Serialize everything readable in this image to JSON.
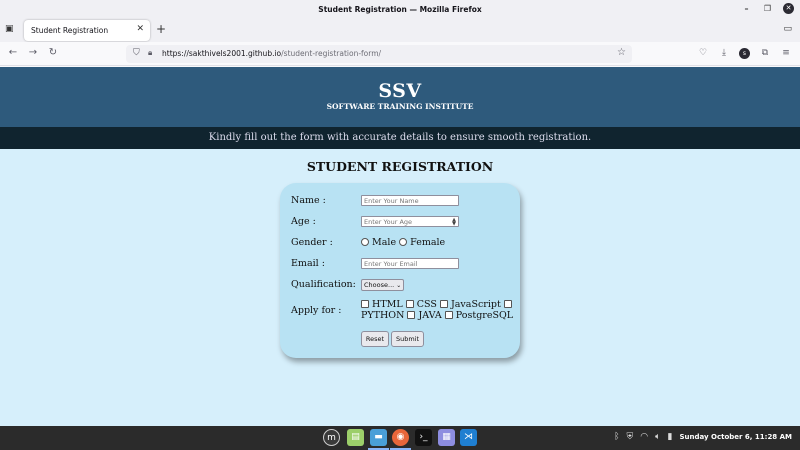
{
  "window": {
    "title": "Student Registration — Mozilla Firefox",
    "minimize_icon": "minimize-icon",
    "restore_icon": "restore-icon",
    "close_icon": "close-icon"
  },
  "tabs": [
    {
      "label": "Student Registration",
      "active": true
    }
  ],
  "navbar": {
    "url_domain": "https://sakthivels2001.github.io",
    "url_path": "/student-registration-form/",
    "icons": [
      "back-icon",
      "forward-icon",
      "reload-icon",
      "shield-icon",
      "lock-icon",
      "bookmark-star-icon",
      "pocket-icon",
      "download-icon",
      "account-icon",
      "extensions-icon",
      "menu-icon"
    ],
    "account_initial": "s"
  },
  "site": {
    "brand": "SSV",
    "brand_subtitle": "SOFTWARE TRAINING INSTITUTE",
    "banner_text": "Kindly fill out the form with accurate details to ensure smooth registration.",
    "header_color": "#2e5a7c",
    "banner_color": "#10242f",
    "page_bg": "#d6effb",
    "card_bg": "#b8e2f3"
  },
  "form": {
    "title": "STUDENT REGISTRATION",
    "name_label": "Name :",
    "name_placeholder": "Enter Your Name",
    "age_label": "Age :",
    "age_placeholder": "Enter Your Age",
    "gender_label": "Gender :",
    "gender_options": [
      "Male",
      "Female"
    ],
    "email_label": "Email :",
    "email_placeholder": "Enter Your Email",
    "qualification_label": "Qualification:",
    "qualification_value": "Choose...",
    "apply_label": "Apply for :",
    "courses": [
      "HTML",
      "CSS",
      "JavaScript",
      "PYTHON",
      "JAVA",
      "PostgreSQL"
    ],
    "reset_label": "Reset",
    "submit_label": "Submit"
  },
  "taskbar": {
    "apps": [
      "mint-menu-icon",
      "software-manager-icon",
      "files-icon",
      "firefox-icon",
      "terminal-icon",
      "text-editor-icon",
      "vscode-icon"
    ],
    "clock": "Sunday October  6, 11:28 AM"
  }
}
